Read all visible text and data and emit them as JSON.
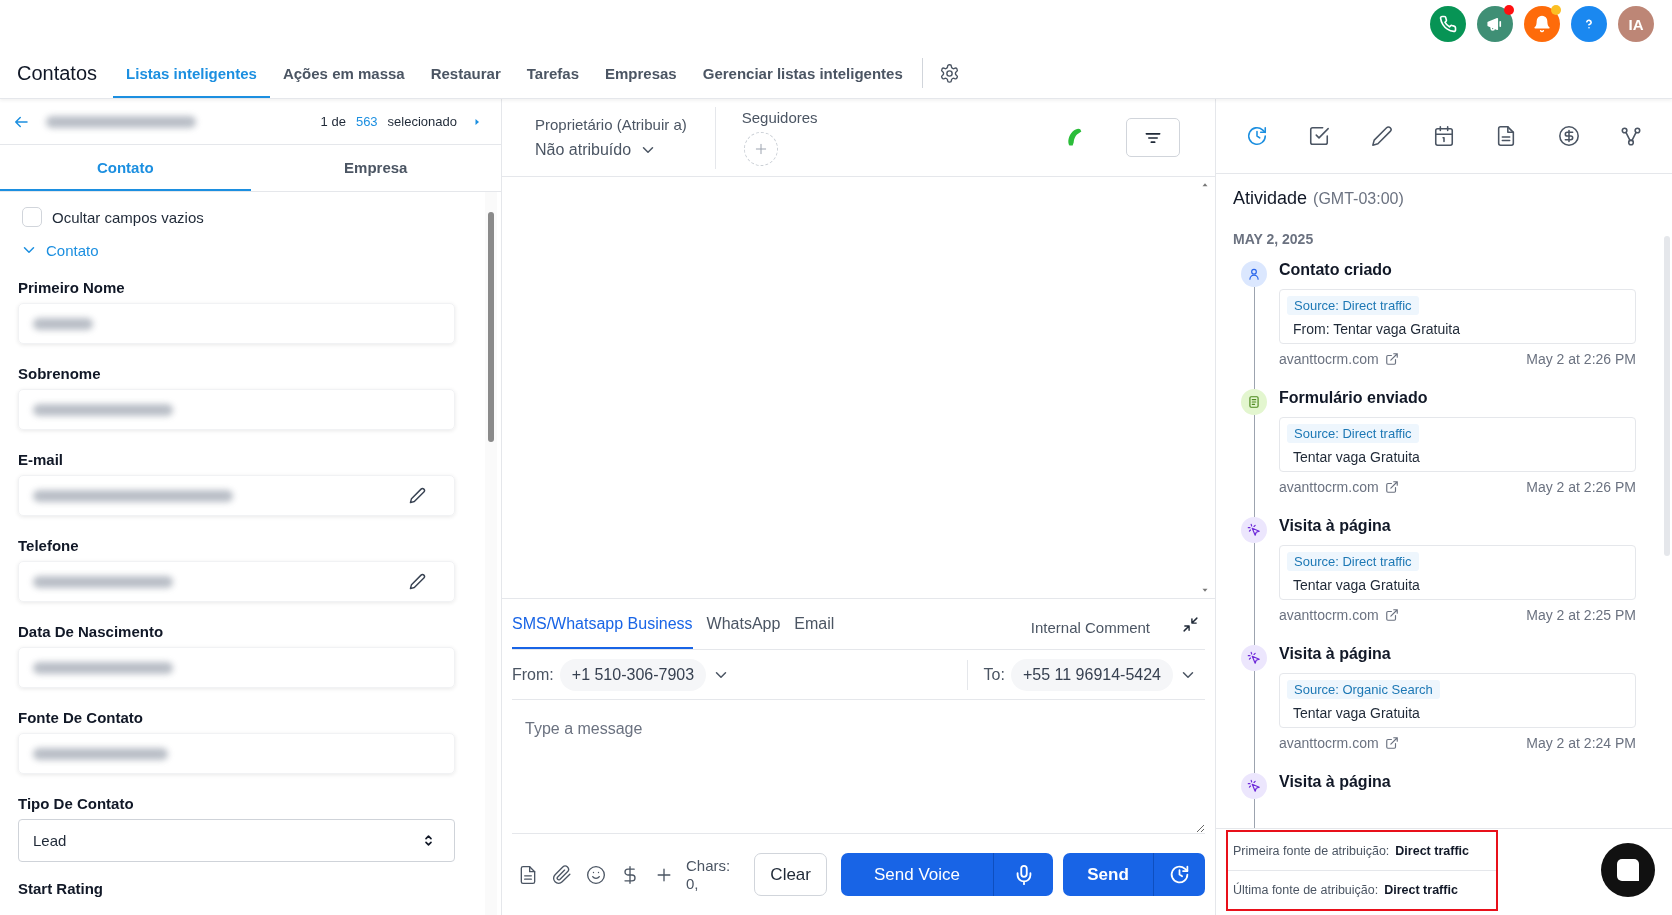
{
  "top_bar": {
    "buttons": [
      {
        "kind": "phone",
        "notification": false
      },
      {
        "kind": "megaphone",
        "notification": true
      },
      {
        "kind": "bell",
        "notification": true
      },
      {
        "kind": "help",
        "notification": false
      }
    ],
    "avatar_initials": "IA"
  },
  "nav": {
    "title": "Contatos",
    "tabs": [
      {
        "label": "Listas inteligentes",
        "selected": true
      },
      {
        "label": "Ações em massa",
        "selected": false
      },
      {
        "label": "Restaurar",
        "selected": false
      },
      {
        "label": "Tarefas",
        "selected": false
      },
      {
        "label": "Empresas",
        "selected": false
      },
      {
        "label": "Gerenciar listas inteligentes",
        "selected": false
      }
    ]
  },
  "record_header": {
    "counter_prefix": "1 de",
    "counter_total": "563",
    "counter_suffix": "selecionado"
  },
  "contact_tabs": [
    {
      "label": "Contato",
      "selected": true
    },
    {
      "label": "Empresa",
      "selected": false
    }
  ],
  "hide_empty": {
    "label": "Ocultar campos vazios",
    "checked": false
  },
  "section": {
    "label": "Contato",
    "expanded": true
  },
  "fields": [
    {
      "label": "Primeiro Nome",
      "kind": "redacted",
      "edit_icon": false
    },
    {
      "label": "Sobrenome",
      "kind": "redacted",
      "edit_icon": false
    },
    {
      "label": "E-mail",
      "kind": "redacted",
      "edit_icon": true
    },
    {
      "label": "Telefone",
      "kind": "redacted",
      "edit_icon": true
    },
    {
      "label": "Data De Nascimento",
      "kind": "redacted",
      "edit_icon": false
    },
    {
      "label": "Fonte De Contato",
      "kind": "redacted",
      "edit_icon": false
    },
    {
      "label": "Tipo De Contato",
      "kind": "select",
      "value": "Lead"
    },
    {
      "label": "Start Rating",
      "kind": "label"
    }
  ],
  "owner": {
    "label": "Proprietário (Atribuir a)",
    "value": "Não atribuído"
  },
  "followers": {
    "label": "Seguidores"
  },
  "composer": {
    "channels": [
      {
        "label": "SMS/Whatsapp Business",
        "selected": true
      },
      {
        "label": "WhatsApp",
        "selected": false
      },
      {
        "label": "Email",
        "selected": false
      }
    ],
    "internal_comment": "Internal Comment",
    "from_label": "From:",
    "from_number": "+1 510-306-7903",
    "to_label": "To:",
    "to_number": "+55 11 96914-5424",
    "placeholder": "Type a message",
    "chars": "Chars: 0,",
    "clear": "Clear",
    "send_voice": "Send Voice",
    "send": "Send"
  },
  "activity": {
    "tabs": [
      {
        "kind": "activity",
        "selected": true
      },
      {
        "kind": "task",
        "selected": false
      },
      {
        "kind": "note",
        "selected": false
      },
      {
        "kind": "calendar",
        "selected": false
      },
      {
        "kind": "document",
        "selected": false
      },
      {
        "kind": "payment",
        "selected": false
      },
      {
        "kind": "workflow",
        "selected": false
      }
    ],
    "title": "Atividade",
    "timezone": "(GMT-03:00)",
    "date": "MAY 2, 2025",
    "events": [
      {
        "kind": "contact",
        "title": "Contato criado",
        "source": "Source: Direct traffic",
        "detail": "From: Tentar vaga Gratuita",
        "site": "avanttocrm.com",
        "time": "May 2 at 2:26 PM"
      },
      {
        "kind": "form",
        "title": "Formulário enviado",
        "source": "Source: Direct traffic",
        "detail": "Tentar vaga Gratuita",
        "site": "avanttocrm.com",
        "time": "May 2 at 2:26 PM"
      },
      {
        "kind": "visit",
        "title": "Visita à página",
        "source": "Source: Direct traffic",
        "detail": "Tentar vaga Gratuita",
        "site": "avanttocrm.com",
        "time": "May 2 at 2:25 PM"
      },
      {
        "kind": "visit",
        "title": "Visita à página",
        "source": "Source: Organic Search",
        "detail": "Tentar vaga Gratuita",
        "site": "avanttocrm.com",
        "time": "May 2 at 2:24 PM"
      },
      {
        "kind": "visit",
        "title": "Visita à página"
      }
    ]
  },
  "attribution": [
    {
      "label": "Primeira fonte de atribuição:",
      "value": "Direct traffic"
    },
    {
      "label": "Última fonte de atribuição:",
      "value": "Direct traffic"
    }
  ]
}
